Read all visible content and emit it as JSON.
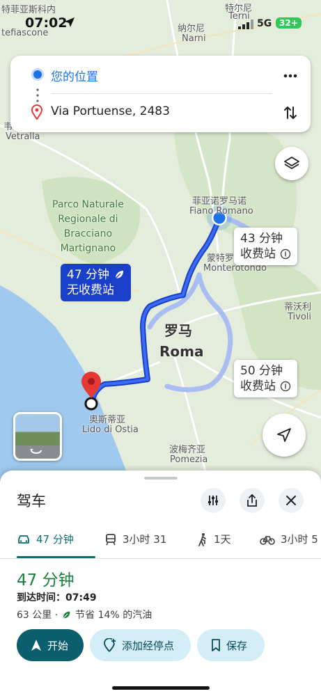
{
  "status_bar": {
    "time": "07:02",
    "network": "5G",
    "battery": "32+"
  },
  "search": {
    "origin": "您的位置",
    "destination": "Via Portuense, 2483"
  },
  "map": {
    "labels": {
      "montefiascone": "tefiascone",
      "tl_city": "特菲亚斯科内",
      "terni_cn": "特尔尼",
      "terni": "Terni",
      "narni_cn": "纳尔尼",
      "narni": "Narni",
      "vetralla_cn": "韦",
      "vetralla": "Vetralla",
      "park": "Parco Naturale\nRegionale di\nBracciano\nMartignano",
      "fiano_cn": "菲亚诺罗马诺",
      "fiano": "Fiano Romano",
      "monterotondo_cn": "蒙特罗",
      "monterotondo": "Monterotondo",
      "roma_cn": "罗马",
      "roma": "Roma",
      "tivoli_cn": "蒂沃利",
      "tivoli": "Tivoli",
      "ostia_cn": "奥斯蒂亚",
      "ostia": "Lido di Ostia",
      "pomezia_cn": "波梅齐亚",
      "pomezia": "Pomezia"
    },
    "routes": [
      {
        "line1": "47 分钟",
        "line2": "无收费站",
        "selected": true
      },
      {
        "line1": "43 分钟",
        "line2": "收费站",
        "selected": false
      },
      {
        "line1": "50 分钟",
        "line2": "收费站",
        "selected": false
      }
    ]
  },
  "sheet": {
    "title": "驾车",
    "modes": [
      {
        "icon": "car-icon",
        "label": "47 分钟",
        "active": true
      },
      {
        "icon": "transit-icon",
        "label": "3小时 31",
        "active": false
      },
      {
        "icon": "walk-icon",
        "label": "1天",
        "active": false
      },
      {
        "icon": "bike-icon",
        "label": "3小时 5",
        "active": false
      }
    ],
    "duration": "47 分钟",
    "arrival": "到达时间：07:49",
    "distance": "63 公里 ·",
    "fuel": "节省 14% 的汽油",
    "buttons": {
      "start": "开始",
      "add_stop": "添加经停点",
      "save": "保存"
    }
  },
  "colors": {
    "route_selected": "#1a3fc8",
    "route_alt": "#a9bdf2",
    "accent": "#0b5e6b",
    "green": "#188038"
  }
}
